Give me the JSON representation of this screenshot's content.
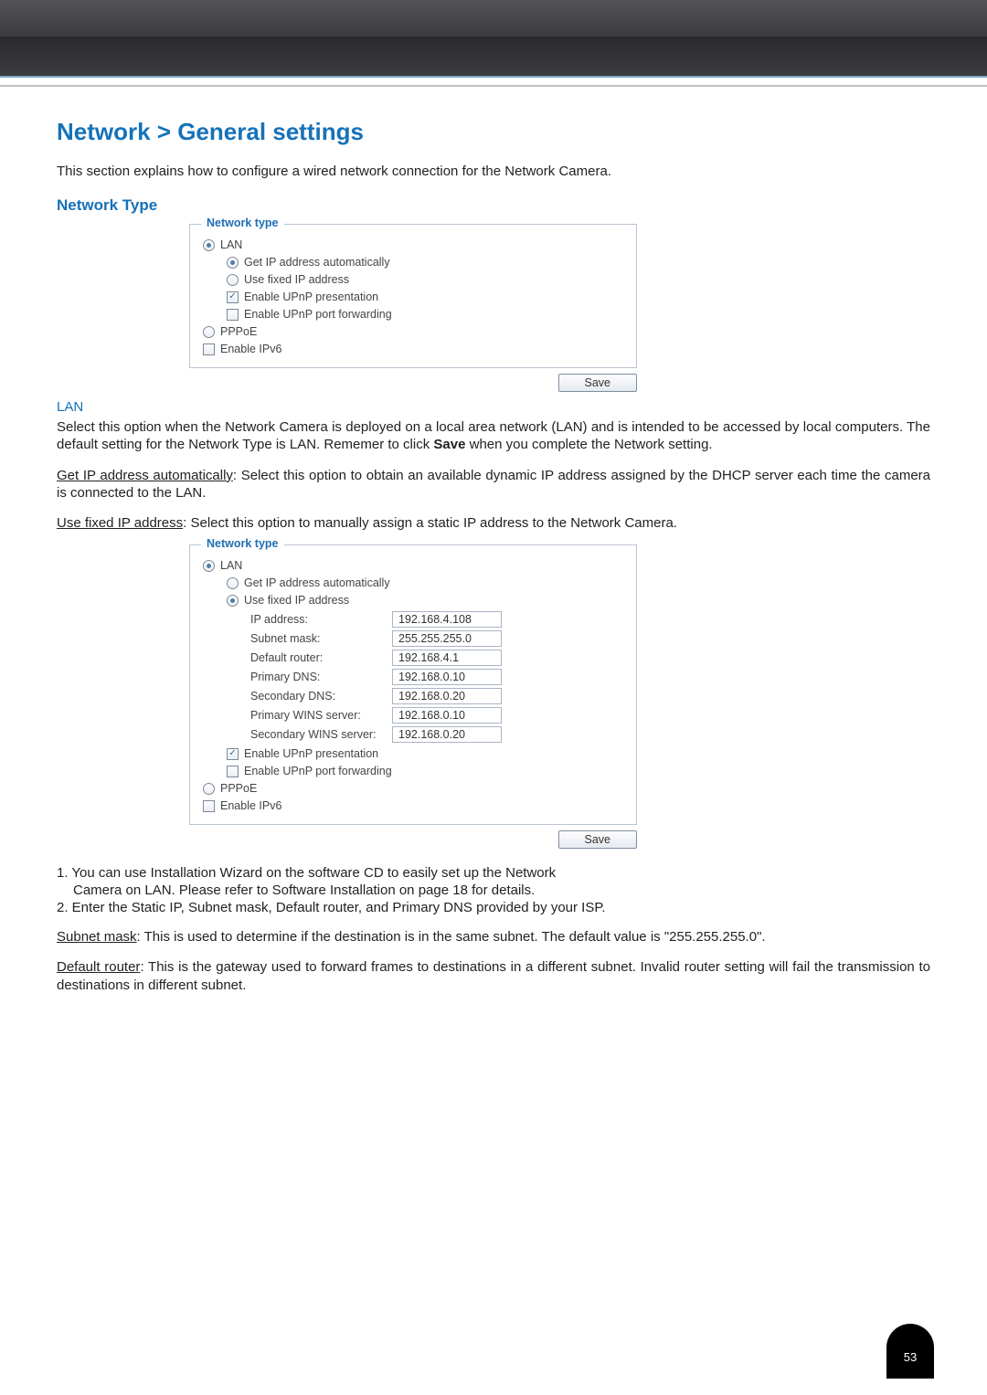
{
  "page_number": "53",
  "heading": "Network > General settings",
  "intro": "This section explains how to configure a wired network connection for the Network Camera.",
  "section_network_type": "Network Type",
  "panel1": {
    "legend": "Network type",
    "lan": "LAN",
    "get_auto": "Get IP address automatically",
    "use_fixed": "Use fixed IP address",
    "upnp_pres": "Enable UPnP presentation",
    "upnp_port": "Enable UPnP port forwarding",
    "pppoe": "PPPoE",
    "ipv6": "Enable IPv6",
    "save": "Save"
  },
  "lan_heading": "LAN",
  "lan_para": "Select this option when the Network Camera is deployed on a local area network (LAN) and is intended to be accessed by local computers. The default setting for the Network Type is LAN. Rememer to click ",
  "lan_para_bold": "Save",
  "lan_para_tail": " when you complete the Network setting.",
  "get_auto_label": "Get IP address automatically",
  "get_auto_text": ": Select this option to obtain an available dynamic IP address assigned by the DHCP server each time the camera is connected to the LAN.",
  "use_fixed_label": "Use fixed IP address",
  "use_fixed_text": ": Select this option to manually assign a static IP address to the Network Camera.",
  "panel2": {
    "legend": "Network type",
    "lan": "LAN",
    "get_auto": "Get IP address automatically",
    "use_fixed": "Use fixed IP address",
    "fields": {
      "ip_label": "IP address:",
      "ip_val": "192.168.4.108",
      "mask_label": "Subnet mask:",
      "mask_val": "255.255.255.0",
      "router_label": "Default router:",
      "router_val": "192.168.4.1",
      "pdns_label": "Primary DNS:",
      "pdns_val": "192.168.0.10",
      "sdns_label": "Secondary DNS:",
      "sdns_val": "192.168.0.20",
      "pwins_label": "Primary WINS server:",
      "pwins_val": "192.168.0.10",
      "swins_label": "Secondary WINS server:",
      "swins_val": "192.168.0.20"
    },
    "upnp_pres": "Enable UPnP presentation",
    "upnp_port": "Enable UPnP port forwarding",
    "pppoe": "PPPoE",
    "ipv6": "Enable IPv6",
    "save": "Save"
  },
  "list": {
    "l1a": "1. You can use Installation Wizard on the software CD to easily set up the Network",
    "l1b": "Camera on LAN. Please refer to Software Installation on page 18 for details.",
    "l2": "2. Enter the Static IP, Subnet mask, Default router, and Primary DNS provided by your ISP."
  },
  "subnet_label": "Subnet mask",
  "subnet_text": ": This is used to determine if the destination is in the same subnet. The default value is \"255.255.255.0\".",
  "router_label": "Default router",
  "router_text": ": This is the gateway used to forward frames to destinations in a different subnet. Invalid router setting will fail the transmission to destinations in different subnet."
}
